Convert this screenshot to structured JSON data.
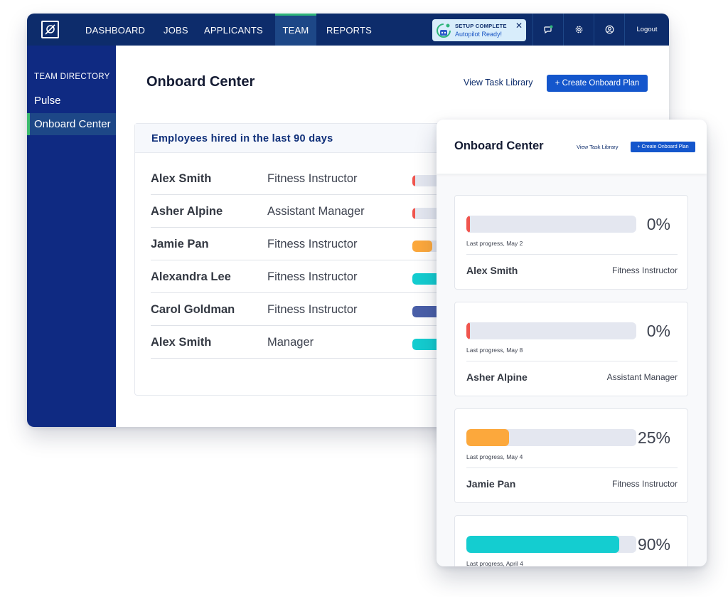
{
  "nav": {
    "items": [
      "DASHBOARD",
      "JOBS",
      "APPLICANTS",
      "TEAM",
      "REPORTS"
    ],
    "active": "TEAM",
    "setup_title": "SETUP COMPLETE",
    "setup_sub": "Autopilot Ready!",
    "close_glyph": "✕",
    "logout": "Logout",
    "icons": [
      "chat-icon",
      "gear-icon",
      "user-icon"
    ]
  },
  "sidebar": {
    "heading": "TEAM DIRECTORY",
    "items": [
      "Pulse",
      "Onboard Center"
    ],
    "active": "Onboard Center"
  },
  "main": {
    "title": "Onboard Center",
    "task_link": "View Task Library",
    "create_button": "+ Create Onboard Plan",
    "card_title": "Employees hired in the last 90 days",
    "rows": [
      {
        "name": "Alex Smith",
        "role": "Fitness Instructor",
        "progress": 0,
        "color": "#f0554e"
      },
      {
        "name": "Asher Alpine",
        "role": "Assistant Manager",
        "progress": 0,
        "color": "#f0554e"
      },
      {
        "name": "Jamie Pan",
        "role": "Fitness Instructor",
        "progress": 25,
        "color": "#fca83c"
      },
      {
        "name": "Alexandra Lee",
        "role": "Fitness Instructor",
        "progress": 90,
        "color": "#14cdd0"
      },
      {
        "name": "Carol Goldman",
        "role": "Fitness Instructor",
        "progress": 50,
        "color": "#4a5fa8"
      },
      {
        "name": "Alex Smith",
        "role": "Manager",
        "progress": 90,
        "color": "#14cdd0"
      }
    ]
  },
  "mobile": {
    "title": "Onboard Center",
    "task_link": "View Task Library",
    "create_button": "+ Create Onboard Plan",
    "cards": [
      {
        "pct": "0%",
        "progress": 0,
        "color": "#f0554e",
        "last": "Last progress, May 2",
        "name": "Alex Smith",
        "role": "Fitness Instructor"
      },
      {
        "pct": "0%",
        "progress": 0,
        "color": "#f0554e",
        "last": "Last progress, May 8",
        "name": "Asher Alpine",
        "role": "Assistant Manager"
      },
      {
        "pct": "25%",
        "progress": 25,
        "color": "#fca83c",
        "last": "Last progress, May 4",
        "name": "Jamie Pan",
        "role": "Fitness Instructor"
      },
      {
        "pct": "90%",
        "progress": 90,
        "color": "#14cdd0",
        "last": "Last progress, April 4",
        "name": "",
        "role": ""
      }
    ]
  }
}
